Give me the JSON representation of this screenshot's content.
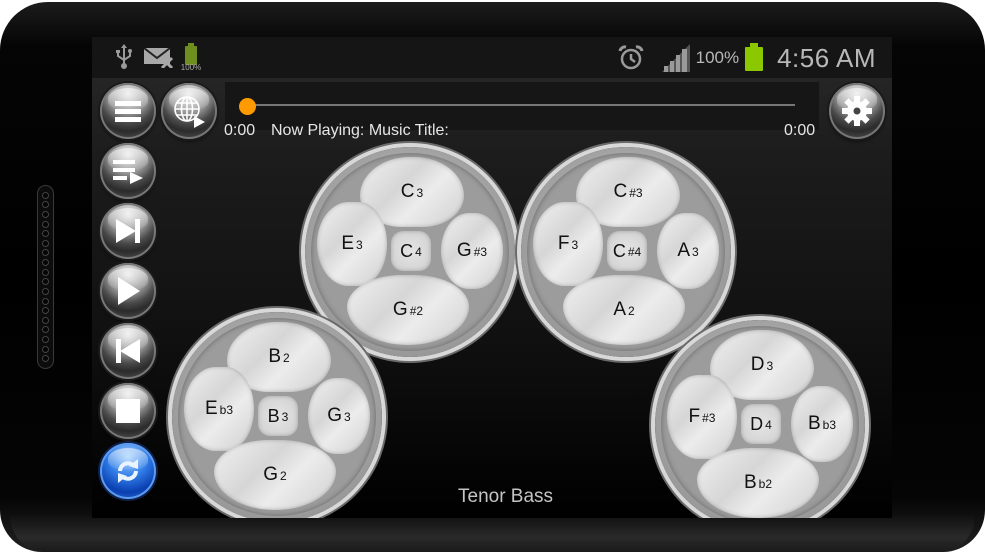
{
  "status_bar": {
    "left_icons": [
      "usb-icon",
      "mail-muted-icon",
      "battery-charged-icon"
    ],
    "small_battery_label": "100%",
    "right_icons": [
      "alarm-icon",
      "signal-icon",
      "battery-icon"
    ],
    "battery_percent": "100%",
    "time": "4:56 AM",
    "battery_color": "#8cc800"
  },
  "toolbar": {
    "menu_button": "menu-icon",
    "web_button": "globe-play-icon",
    "settings_button": "gear-icon"
  },
  "player": {
    "elapsed": "0:00",
    "duration": "0:00",
    "now_playing_label": "Now Playing:  Music Title:",
    "progress": 0,
    "thumb_color": "#ff9a00"
  },
  "side_controls": [
    {
      "name": "playlist",
      "icon": "playlist-play-icon"
    },
    {
      "name": "next",
      "icon": "skip-next-icon"
    },
    {
      "name": "play",
      "icon": "play-icon"
    },
    {
      "name": "previous",
      "icon": "skip-previous-icon"
    },
    {
      "name": "stop",
      "icon": "stop-icon"
    },
    {
      "name": "repeat",
      "icon": "repeat-icon",
      "active": true
    }
  ],
  "pans": [
    {
      "name": "pan-c",
      "top": {
        "note": "C",
        "mod": "3"
      },
      "left": {
        "note": "E",
        "mod": "3"
      },
      "center": {
        "note": "C",
        "mod": "4"
      },
      "right": {
        "note": "G",
        "mod": "#3"
      },
      "bottom": {
        "note": "G",
        "mod": "#2"
      }
    },
    {
      "name": "pan-c-sharp",
      "top": {
        "note": "C",
        "mod": "#3"
      },
      "left": {
        "note": "F",
        "mod": "3"
      },
      "center": {
        "note": "C",
        "mod": "#4"
      },
      "right": {
        "note": "A",
        "mod": "3"
      },
      "bottom": {
        "note": "A",
        "mod": "2"
      }
    },
    {
      "name": "pan-b",
      "top": {
        "note": "B",
        "mod": "2"
      },
      "left": {
        "note": "E",
        "mod": "b3"
      },
      "center": {
        "note": "B",
        "mod": "3"
      },
      "right": {
        "note": "G",
        "mod": "3"
      },
      "bottom": {
        "note": "G",
        "mod": "2"
      }
    },
    {
      "name": "pan-d",
      "top": {
        "note": "D",
        "mod": "3"
      },
      "left": {
        "note": "F",
        "mod": "#3"
      },
      "center": {
        "note": "D",
        "mod": "4"
      },
      "right": {
        "note": "B",
        "mod": "b3"
      },
      "bottom": {
        "note": "B",
        "mod": "b2"
      }
    }
  ],
  "instrument_name": "Tenor Bass"
}
